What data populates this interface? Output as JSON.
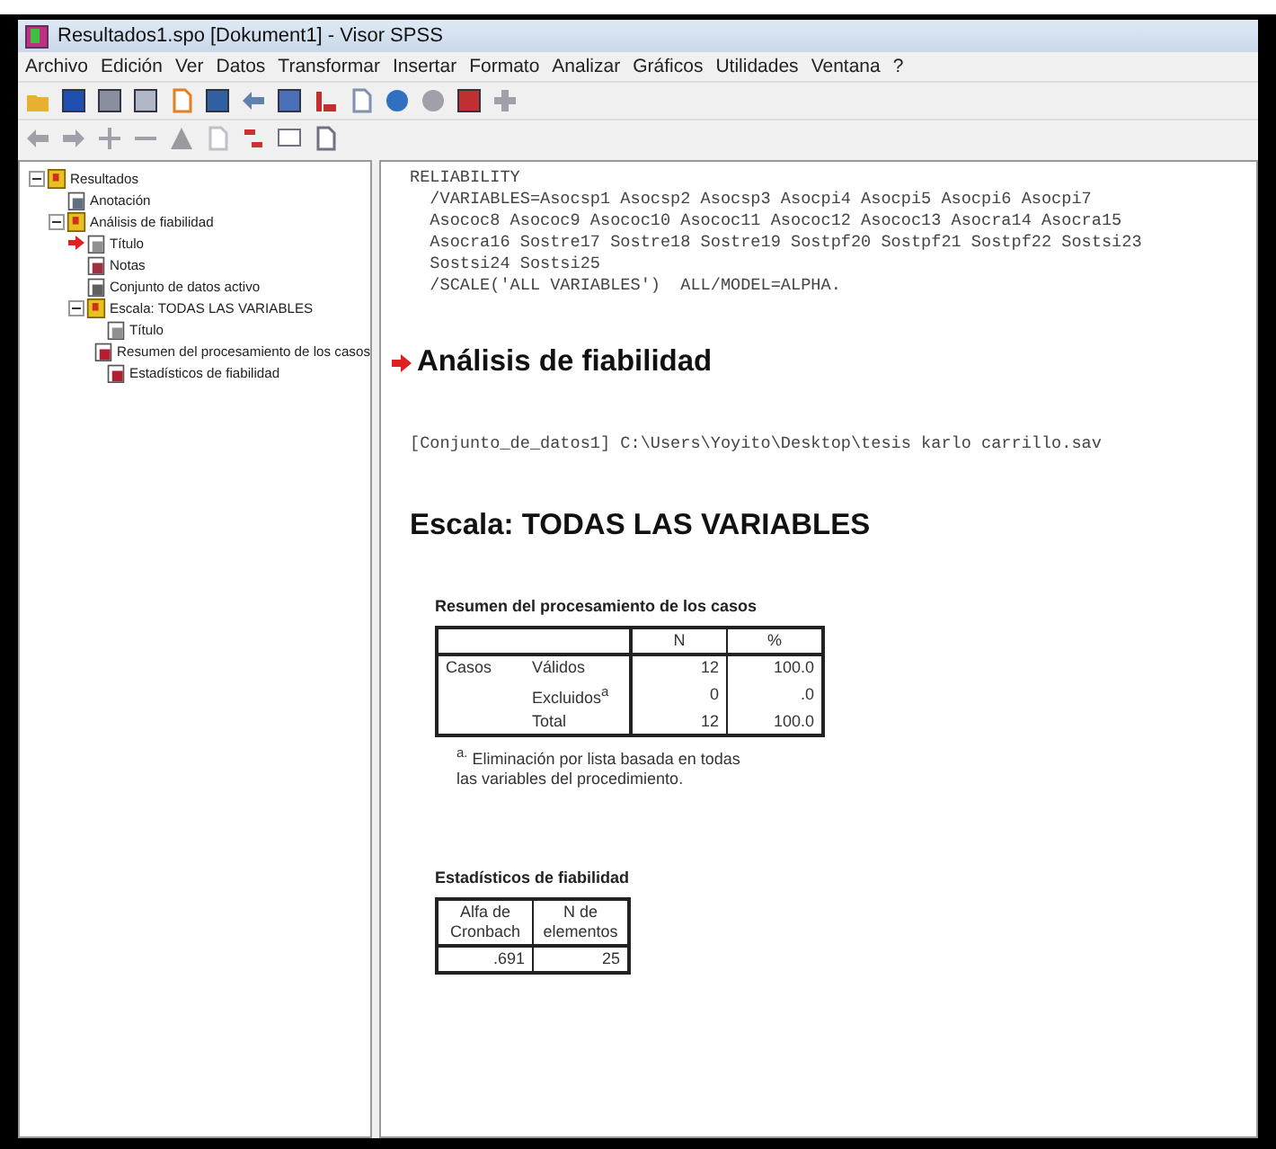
{
  "window": {
    "title": "Resultados1.spo [Dokument1] - Visor SPSS"
  },
  "menu": [
    "Archivo",
    "Edición",
    "Ver",
    "Datos",
    "Transformar",
    "Insertar",
    "Formato",
    "Analizar",
    "Gráficos",
    "Utilidades",
    "Ventana",
    "?"
  ],
  "tree": [
    {
      "label": "Resultados",
      "kind": "folder",
      "expanded": true,
      "children": [
        {
          "label": "Anotación",
          "kind": "note",
          "current": false
        },
        {
          "label": "Análisis de fiabilidad",
          "kind": "folder",
          "expanded": true,
          "children": [
            {
              "label": "Título",
              "kind": "title",
              "current": true
            },
            {
              "label": "Notas",
              "kind": "notes",
              "current": false
            },
            {
              "label": "Conjunto de datos activo",
              "kind": "dataset",
              "current": false
            },
            {
              "label": "Escala: TODAS LAS VARIABLES",
              "kind": "folder",
              "expanded": true,
              "children": [
                {
                  "label": "Título",
                  "kind": "title",
                  "current": false
                },
                {
                  "label": "Resumen del procesamiento de los casos",
                  "kind": "table",
                  "current": false
                },
                {
                  "label": "Estadísticos de fiabilidad",
                  "kind": "table",
                  "current": false
                }
              ]
            }
          ]
        }
      ]
    }
  ],
  "output": {
    "syntax": [
      "RELIABILITY",
      "  /VARIABLES=Asocsp1 Asocsp2 Asocsp3 Asocpi4 Asocpi5 Asocpi6 Asocpi7",
      "  Asococ8 Asococ9 Asococ10 Asococ11 Asococ12 Asococ13 Asocra14 Asocra15",
      "  Asocra16 Sostre17 Sostre18 Sostre19 Sostpf20 Sostpf21 Sostpf22 Sostsi23",
      "  Sostsi24 Sostsi25",
      "  /SCALE('ALL VARIABLES')  ALL/MODEL=ALPHA."
    ],
    "heading": "Análisis de fiabilidad",
    "dataset": "[Conjunto_de_datos1] C:\\Users\\Yoyito\\Desktop\\tesis karlo carrillo.sav",
    "scale_heading": "Escala: TODAS LAS VARIABLES",
    "case_summary": {
      "title": "Resumen del procesamiento de los casos",
      "columns": [
        "",
        "",
        "N",
        "%"
      ],
      "rows": [
        [
          "Casos",
          "Válidos",
          "12",
          "100.0"
        ],
        [
          "",
          "Excluidos$^{a}$",
          "0",
          ".0"
        ],
        [
          "",
          "Total",
          "12",
          "100.0"
        ]
      ],
      "footnote": "$^{a.}$ Eliminación por lista basada en todas las variables del procedimiento."
    },
    "reliability": {
      "title": "Estadísticos de fiabilidad",
      "columns": [
        "Alfa de Cronbach",
        "N de elementos"
      ],
      "rows": [
        [
          ".691",
          "25"
        ]
      ]
    }
  }
}
